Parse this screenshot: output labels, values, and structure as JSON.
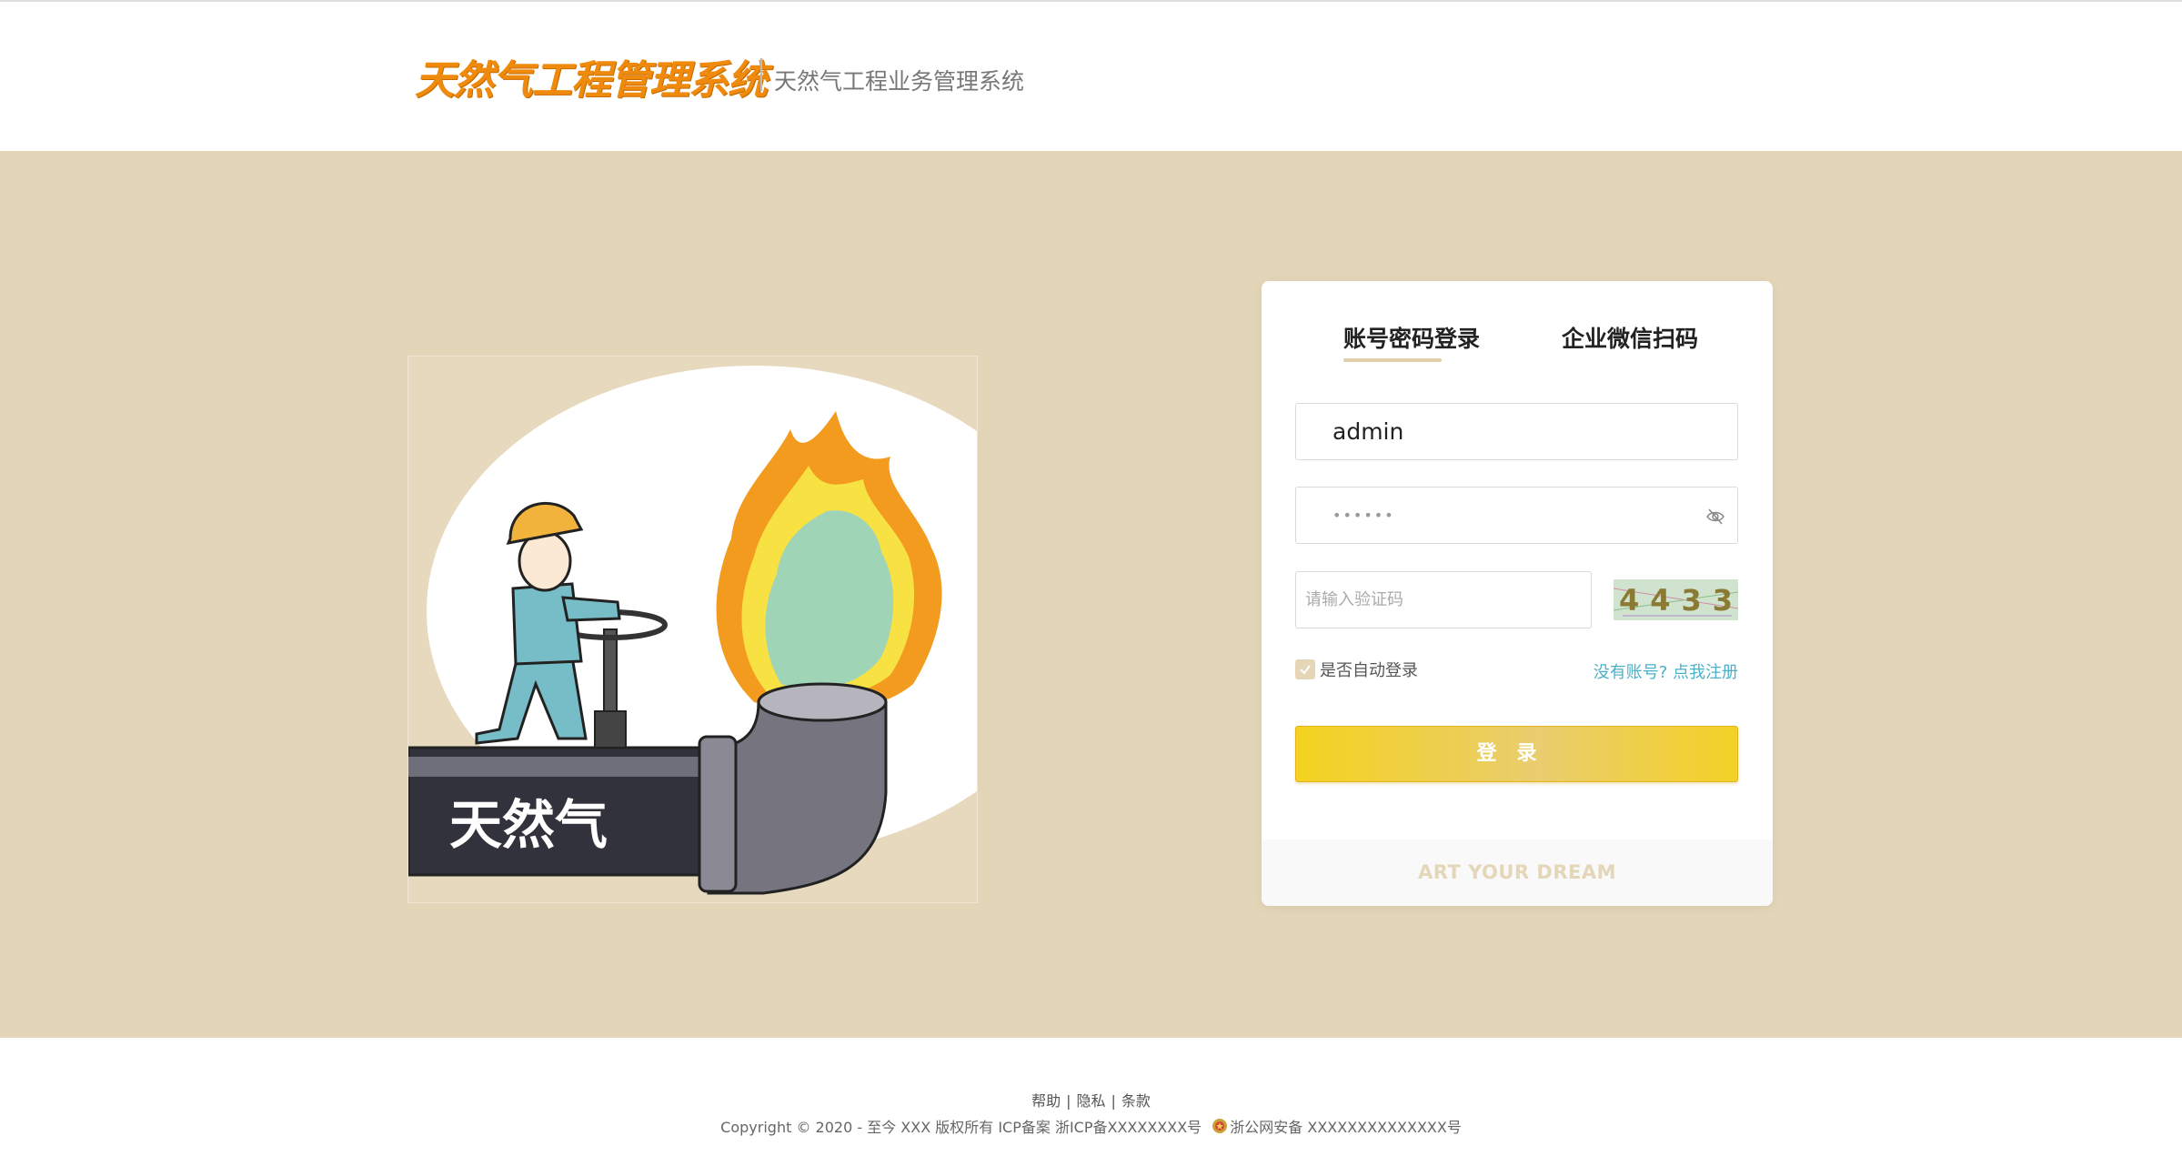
{
  "header": {
    "logo_text": "天然气工程管理系统",
    "subtitle": "天然气工程业务管理系统"
  },
  "illustration": {
    "pipe_label": "天然气"
  },
  "login": {
    "tabs": [
      {
        "label": "账号密码登录",
        "active": true
      },
      {
        "label": "企业微信扫码",
        "active": false
      }
    ],
    "username_value": "admin",
    "password_mask": "••••••",
    "captcha_placeholder": "请输入验证码",
    "captcha_text": "4433",
    "remember_label": "是否自动登录",
    "remember_checked": true,
    "register_link": "没有账号? 点我注册",
    "submit_label": "登录",
    "slogan": "ART YOUR DREAM"
  },
  "footer": {
    "links": [
      "帮助",
      "隐私",
      "条款"
    ],
    "copyright": "Copyright © 2020 - 至今 XXX 版权所有 ICP备案 浙ICP备XXXXXXXX号",
    "police_record": "浙公网安备 XXXXXXXXXXXXXX号"
  },
  "colors": {
    "band": "#e3d5b7",
    "logo": "#f08a0c",
    "accent_gold": "#f4d21f",
    "link": "#4bb1c9"
  }
}
